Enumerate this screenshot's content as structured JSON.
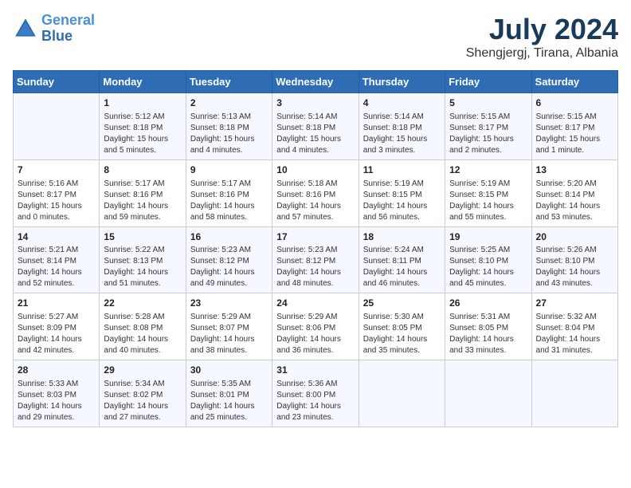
{
  "header": {
    "logo_line1": "General",
    "logo_line2": "Blue",
    "main_title": "July 2024",
    "subtitle": "Shengjergj, Tirana, Albania"
  },
  "days_of_week": [
    "Sunday",
    "Monday",
    "Tuesday",
    "Wednesday",
    "Thursday",
    "Friday",
    "Saturday"
  ],
  "weeks": [
    [
      {
        "day": "",
        "info": ""
      },
      {
        "day": "1",
        "info": "Sunrise: 5:12 AM\nSunset: 8:18 PM\nDaylight: 15 hours\nand 5 minutes."
      },
      {
        "day": "2",
        "info": "Sunrise: 5:13 AM\nSunset: 8:18 PM\nDaylight: 15 hours\nand 4 minutes."
      },
      {
        "day": "3",
        "info": "Sunrise: 5:14 AM\nSunset: 8:18 PM\nDaylight: 15 hours\nand 4 minutes."
      },
      {
        "day": "4",
        "info": "Sunrise: 5:14 AM\nSunset: 8:18 PM\nDaylight: 15 hours\nand 3 minutes."
      },
      {
        "day": "5",
        "info": "Sunrise: 5:15 AM\nSunset: 8:17 PM\nDaylight: 15 hours\nand 2 minutes."
      },
      {
        "day": "6",
        "info": "Sunrise: 5:15 AM\nSunset: 8:17 PM\nDaylight: 15 hours\nand 1 minute."
      }
    ],
    [
      {
        "day": "7",
        "info": "Sunrise: 5:16 AM\nSunset: 8:17 PM\nDaylight: 15 hours\nand 0 minutes."
      },
      {
        "day": "8",
        "info": "Sunrise: 5:17 AM\nSunset: 8:16 PM\nDaylight: 14 hours\nand 59 minutes."
      },
      {
        "day": "9",
        "info": "Sunrise: 5:17 AM\nSunset: 8:16 PM\nDaylight: 14 hours\nand 58 minutes."
      },
      {
        "day": "10",
        "info": "Sunrise: 5:18 AM\nSunset: 8:16 PM\nDaylight: 14 hours\nand 57 minutes."
      },
      {
        "day": "11",
        "info": "Sunrise: 5:19 AM\nSunset: 8:15 PM\nDaylight: 14 hours\nand 56 minutes."
      },
      {
        "day": "12",
        "info": "Sunrise: 5:19 AM\nSunset: 8:15 PM\nDaylight: 14 hours\nand 55 minutes."
      },
      {
        "day": "13",
        "info": "Sunrise: 5:20 AM\nSunset: 8:14 PM\nDaylight: 14 hours\nand 53 minutes."
      }
    ],
    [
      {
        "day": "14",
        "info": "Sunrise: 5:21 AM\nSunset: 8:14 PM\nDaylight: 14 hours\nand 52 minutes."
      },
      {
        "day": "15",
        "info": "Sunrise: 5:22 AM\nSunset: 8:13 PM\nDaylight: 14 hours\nand 51 minutes."
      },
      {
        "day": "16",
        "info": "Sunrise: 5:23 AM\nSunset: 8:12 PM\nDaylight: 14 hours\nand 49 minutes."
      },
      {
        "day": "17",
        "info": "Sunrise: 5:23 AM\nSunset: 8:12 PM\nDaylight: 14 hours\nand 48 minutes."
      },
      {
        "day": "18",
        "info": "Sunrise: 5:24 AM\nSunset: 8:11 PM\nDaylight: 14 hours\nand 46 minutes."
      },
      {
        "day": "19",
        "info": "Sunrise: 5:25 AM\nSunset: 8:10 PM\nDaylight: 14 hours\nand 45 minutes."
      },
      {
        "day": "20",
        "info": "Sunrise: 5:26 AM\nSunset: 8:10 PM\nDaylight: 14 hours\nand 43 minutes."
      }
    ],
    [
      {
        "day": "21",
        "info": "Sunrise: 5:27 AM\nSunset: 8:09 PM\nDaylight: 14 hours\nand 42 minutes."
      },
      {
        "day": "22",
        "info": "Sunrise: 5:28 AM\nSunset: 8:08 PM\nDaylight: 14 hours\nand 40 minutes."
      },
      {
        "day": "23",
        "info": "Sunrise: 5:29 AM\nSunset: 8:07 PM\nDaylight: 14 hours\nand 38 minutes."
      },
      {
        "day": "24",
        "info": "Sunrise: 5:29 AM\nSunset: 8:06 PM\nDaylight: 14 hours\nand 36 minutes."
      },
      {
        "day": "25",
        "info": "Sunrise: 5:30 AM\nSunset: 8:05 PM\nDaylight: 14 hours\nand 35 minutes."
      },
      {
        "day": "26",
        "info": "Sunrise: 5:31 AM\nSunset: 8:05 PM\nDaylight: 14 hours\nand 33 minutes."
      },
      {
        "day": "27",
        "info": "Sunrise: 5:32 AM\nSunset: 8:04 PM\nDaylight: 14 hours\nand 31 minutes."
      }
    ],
    [
      {
        "day": "28",
        "info": "Sunrise: 5:33 AM\nSunset: 8:03 PM\nDaylight: 14 hours\nand 29 minutes."
      },
      {
        "day": "29",
        "info": "Sunrise: 5:34 AM\nSunset: 8:02 PM\nDaylight: 14 hours\nand 27 minutes."
      },
      {
        "day": "30",
        "info": "Sunrise: 5:35 AM\nSunset: 8:01 PM\nDaylight: 14 hours\nand 25 minutes."
      },
      {
        "day": "31",
        "info": "Sunrise: 5:36 AM\nSunset: 8:00 PM\nDaylight: 14 hours\nand 23 minutes."
      },
      {
        "day": "",
        "info": ""
      },
      {
        "day": "",
        "info": ""
      },
      {
        "day": "",
        "info": ""
      }
    ]
  ]
}
